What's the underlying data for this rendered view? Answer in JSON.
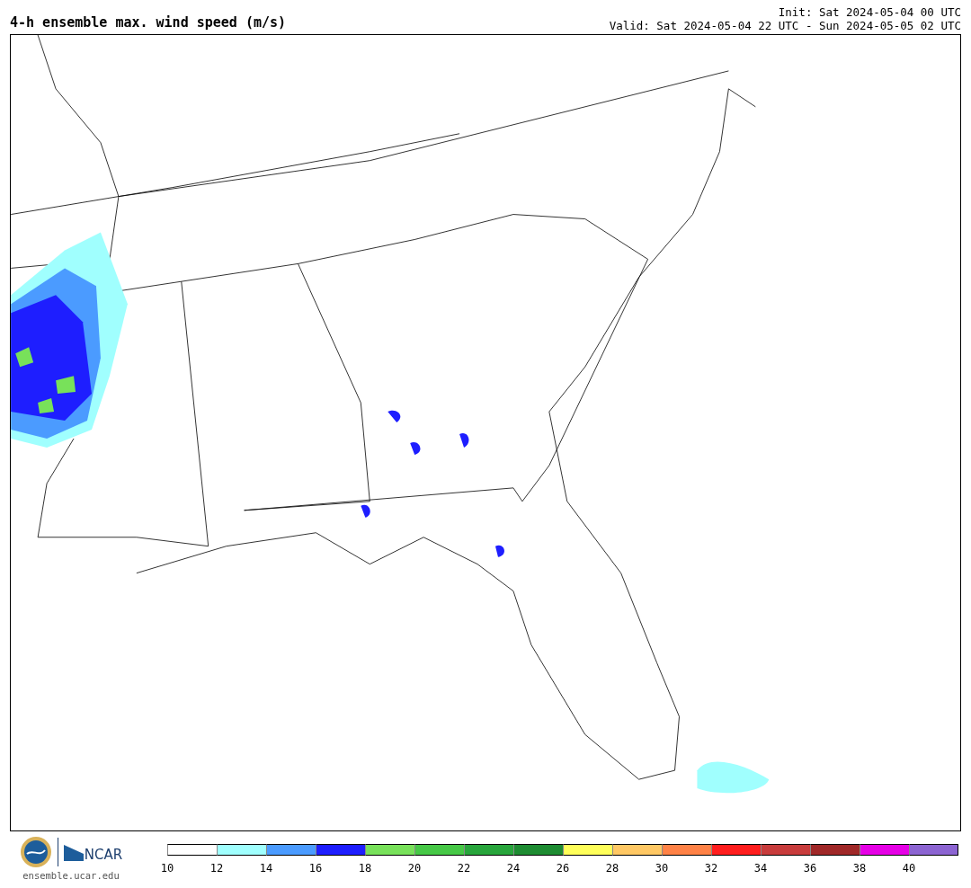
{
  "title": "4-h ensemble max. wind speed (m/s)",
  "init": "Init: Sat 2024-05-04 00 UTC",
  "valid": "Valid: Sat 2024-05-04 22 UTC - Sun 2024-05-05 02 UTC",
  "footer": {
    "logo_text": "NCAR",
    "url": "ensemble.ucar.edu"
  },
  "colorbar": [
    {
      "label": "10",
      "color": "#ffffff"
    },
    {
      "label": "12",
      "color": "#a0fffe"
    },
    {
      "label": "14",
      "color": "#4b9bff"
    },
    {
      "label": "16",
      "color": "#1e1eff"
    },
    {
      "label": "18",
      "color": "#78e15a"
    },
    {
      "label": "20",
      "color": "#46c846"
    },
    {
      "label": "22",
      "color": "#28a53c"
    },
    {
      "label": "24",
      "color": "#1e8c32"
    },
    {
      "label": "26",
      "color": "#ffff5a"
    },
    {
      "label": "28",
      "color": "#ffc864"
    },
    {
      "label": "30",
      "color": "#ff8246"
    },
    {
      "label": "32",
      "color": "#ff1e1e"
    },
    {
      "label": "34",
      "color": "#c83c3c"
    },
    {
      "label": "36",
      "color": "#a02828"
    },
    {
      "label": "38",
      "color": "#e600e6"
    },
    {
      "label": "40",
      "color": "#8c64d2"
    }
  ]
}
